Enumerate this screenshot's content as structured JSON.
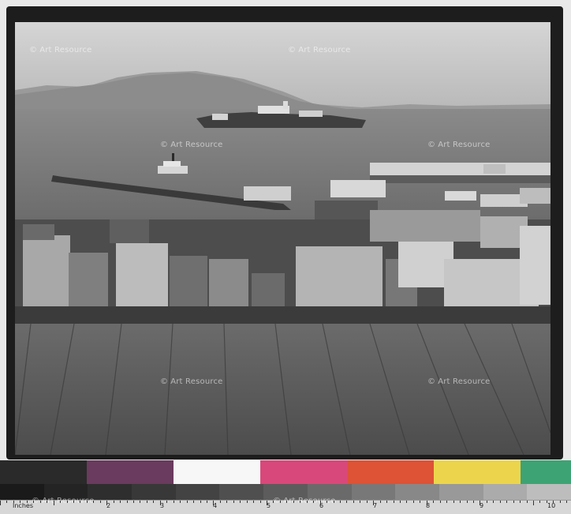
{
  "watermark": {
    "text": "Art Resource",
    "symbol": "©"
  },
  "ruler": {
    "unit_label": "Inches",
    "numbers": [
      "1",
      "2",
      "3",
      "4",
      "5",
      "6",
      "7",
      "8",
      "9",
      "10"
    ]
  },
  "colors": {
    "photo_sky": "#cfcfcf",
    "photo_water": "#6e6e6e",
    "frame": "#1d1d1d",
    "roof": "#5b5b5b"
  },
  "color_patches": [
    {
      "name": "black-patch",
      "color": "#2a2a2a"
    },
    {
      "name": "purple-patch",
      "color": "#6a3b5e"
    },
    {
      "name": "white-patch",
      "color": "#f7f7f7"
    },
    {
      "name": "magenta-patch",
      "color": "#d9487a"
    },
    {
      "name": "red-patch",
      "color": "#de5235"
    },
    {
      "name": "yellow-patch",
      "color": "#ecd54c"
    },
    {
      "name": "green-patch",
      "color": "#3ea374"
    }
  ]
}
